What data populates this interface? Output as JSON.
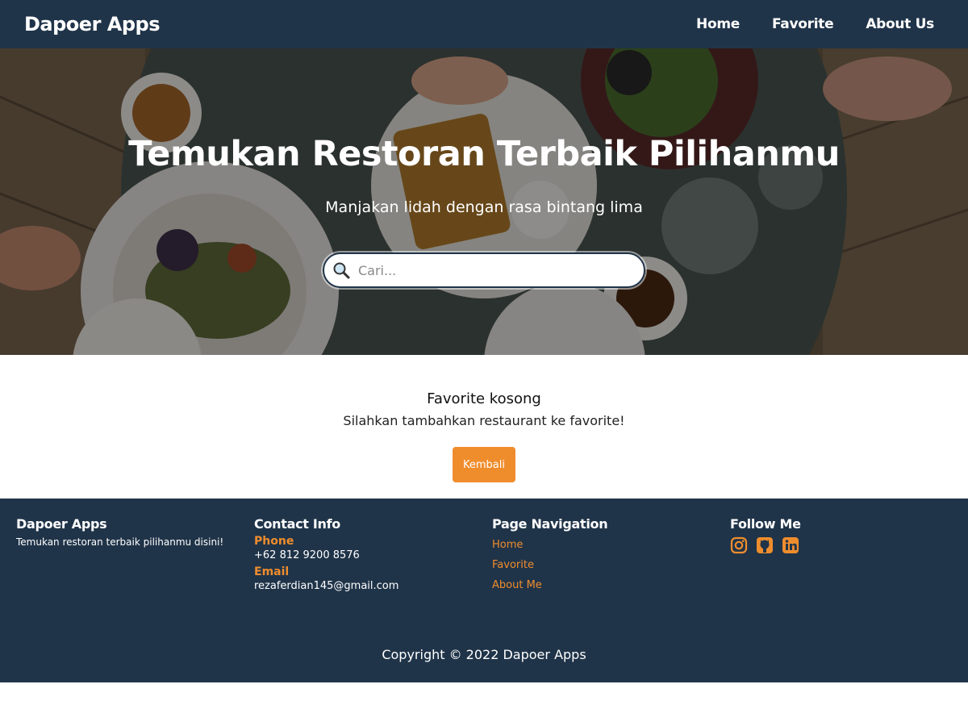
{
  "header": {
    "brand": "Dapoer Apps",
    "nav": [
      {
        "label": "Home"
      },
      {
        "label": "Favorite"
      },
      {
        "label": "About Us"
      }
    ]
  },
  "hero": {
    "title": "Temukan Restoran Terbaik Pilihanmu",
    "subtitle": "Manjakan lidah dengan rasa bintang lima",
    "search": {
      "placeholder": "Cari...",
      "icon": "magnifier-icon"
    }
  },
  "main": {
    "empty_title": "Favorite kosong",
    "empty_description": "Silahkan tambahkan restaurant ke favorite!",
    "back_button": "Kembali"
  },
  "footer": {
    "about": {
      "heading": "Dapoer Apps",
      "text": "Temukan restoran terbaik pilihanmu disini!"
    },
    "contact": {
      "heading": "Contact Info",
      "phone_label": "Phone",
      "phone": "+62 812 9200 8576",
      "email_label": "Email",
      "email": "rezaferdian145@gmail.com"
    },
    "navigation": {
      "heading": "Page Navigation",
      "links": [
        {
          "label": "Home"
        },
        {
          "label": "Favorite"
        },
        {
          "label": "About Me"
        }
      ]
    },
    "follow": {
      "heading": "Follow Me",
      "icons": [
        "instagram-icon",
        "github-icon",
        "linkedin-icon"
      ]
    },
    "copyright": "Copyright © 2022 Dapoer Apps"
  },
  "colors": {
    "primary_dark": "#203449",
    "accent": "#ef8d2d",
    "white": "#ffffff"
  }
}
